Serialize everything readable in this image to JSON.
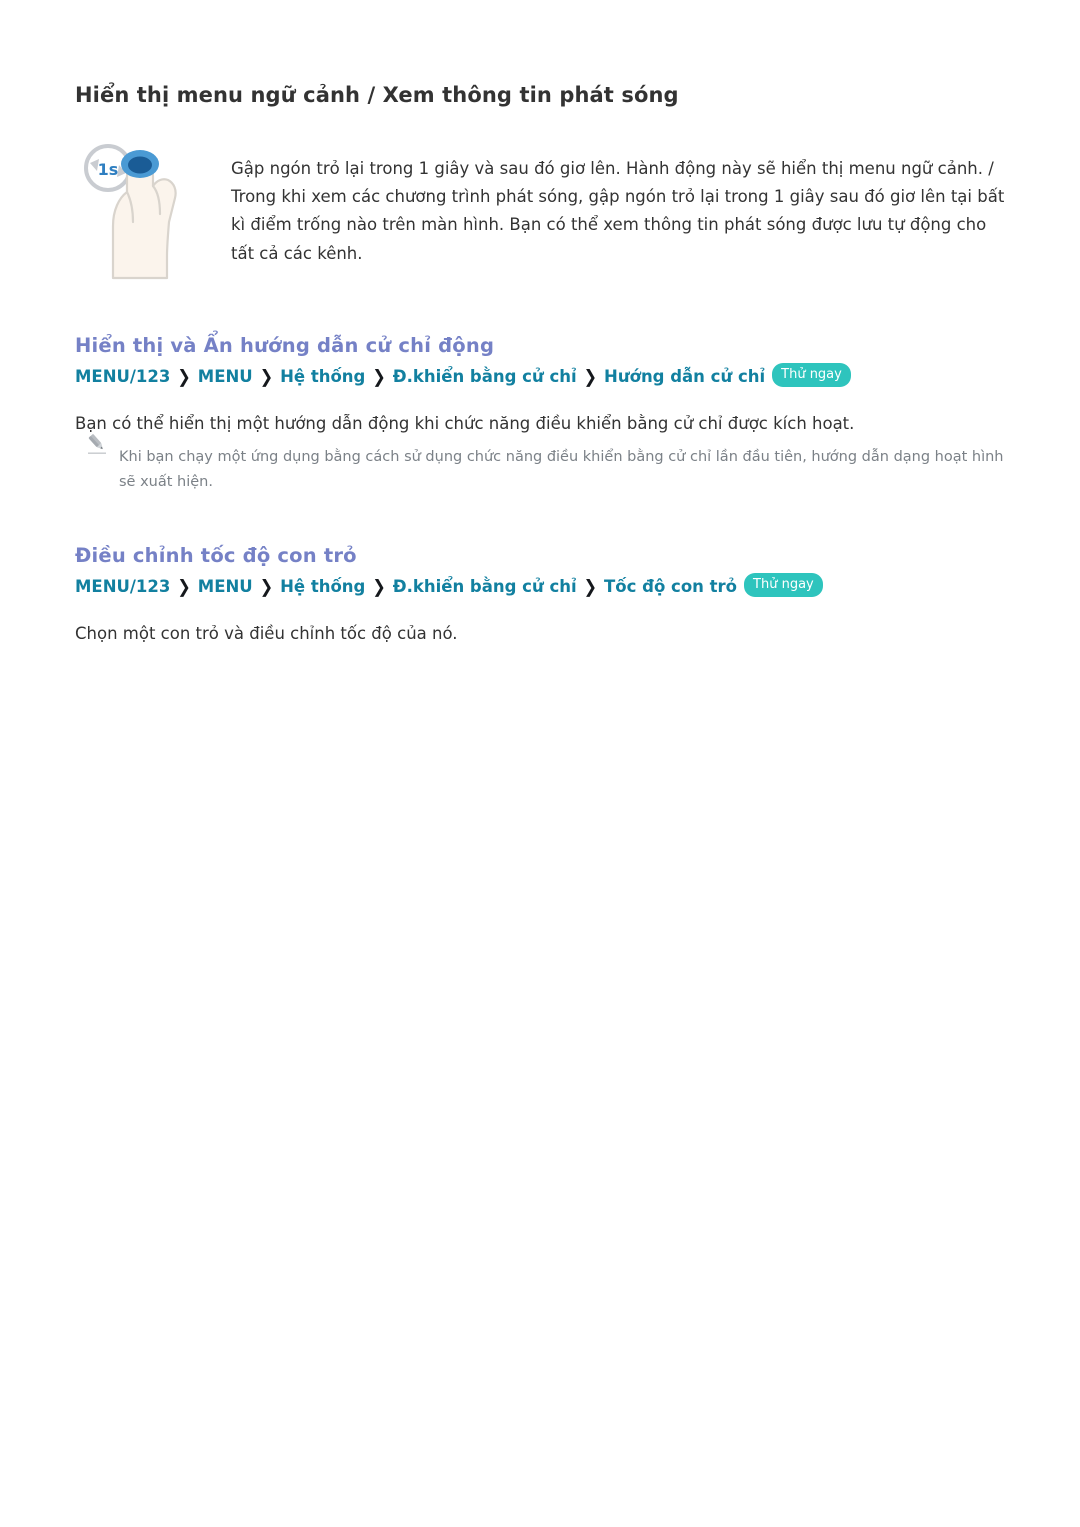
{
  "page": {
    "title": "Hiển thị menu ngữ cảnh / Xem thông tin phát sóng"
  },
  "gesture": {
    "icon_name": "hand-index-finger-hold-1s-icon",
    "timer_label": "1s",
    "description": "Gập ngón trỏ lại trong 1 giây và sau đó giơ lên. Hành động này sẽ hiển thị menu ngữ cảnh. / Trong khi xem các chương trình phát sóng, gập ngón trỏ lại trong 1 giây sau đó giơ lên tại bất kì điểm trống nào trên màn hình. Bạn có thể xem thông tin phát sóng được lưu tự động cho tất cả các kênh."
  },
  "sections": [
    {
      "heading": "Hiển thị và Ẩn hướng dẫn cử chỉ động",
      "menu_path": {
        "items": [
          "MENU/123",
          "MENU",
          "Hệ thống",
          "Đ.khiển bằng cử chỉ",
          "Hướng dẫn cử chỉ"
        ],
        "separator": "❯",
        "badge": "Thử ngay"
      },
      "body": "Bạn có thể hiển thị một hướng dẫn động khi chức năng điều khiển bằng cử chỉ được kích hoạt.",
      "note": {
        "icon_name": "pencil-note-icon",
        "text": "Khi bạn chạy một ứng dụng bằng cách sử dụng chức năng điều khiển bằng cử chỉ lần đầu tiên, hướng dẫn dạng hoạt hình sẽ xuất hiện."
      }
    },
    {
      "heading": "Điều chỉnh tốc độ con trỏ",
      "menu_path": {
        "items": [
          "MENU/123",
          "MENU",
          "Hệ thống",
          "Đ.khiển bằng cử chỉ",
          "Tốc độ con trỏ"
        ],
        "separator": "❯",
        "badge": "Thử ngay"
      },
      "body": "Chọn một con trỏ và điều chỉnh tốc độ của nó."
    }
  ],
  "colors": {
    "heading_blue": "#7581c6",
    "menu_teal": "#1280a0",
    "badge_teal": "#2ec4bd",
    "body_dark": "#333333",
    "note_gray": "#7b8187",
    "icon_blue": "#2f7fc1",
    "icon_skin": "#fbf4ec"
  }
}
